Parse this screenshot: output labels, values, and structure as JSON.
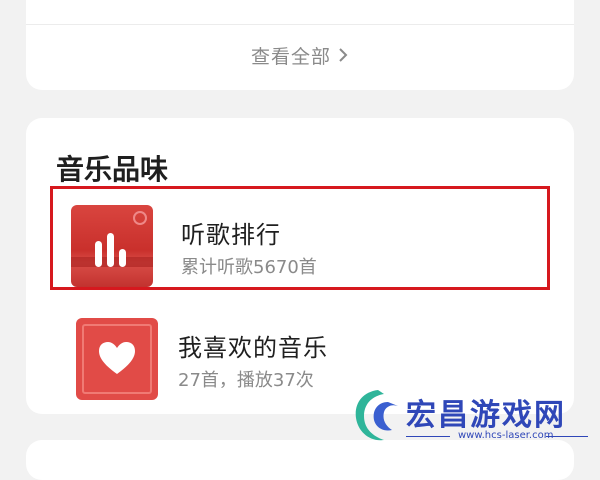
{
  "top_card": {
    "view_all_label": "查看全部"
  },
  "section": {
    "title": "音乐品味"
  },
  "items": [
    {
      "title": "听歌排行",
      "subtitle": "累计听歌5670首"
    },
    {
      "title": "我喜欢的音乐",
      "subtitle": "27首，播放37次"
    }
  ],
  "watermark": {
    "name": "宏昌游戏网",
    "url": "www.hcs-laser.com"
  },
  "colors": {
    "accent": "#d6181e",
    "thumb_red": "#d9453f",
    "watermark_blue": "#2f47b8"
  },
  "icons": [
    "chevron-right-icon",
    "bar-chart-icon",
    "heart-icon"
  ]
}
